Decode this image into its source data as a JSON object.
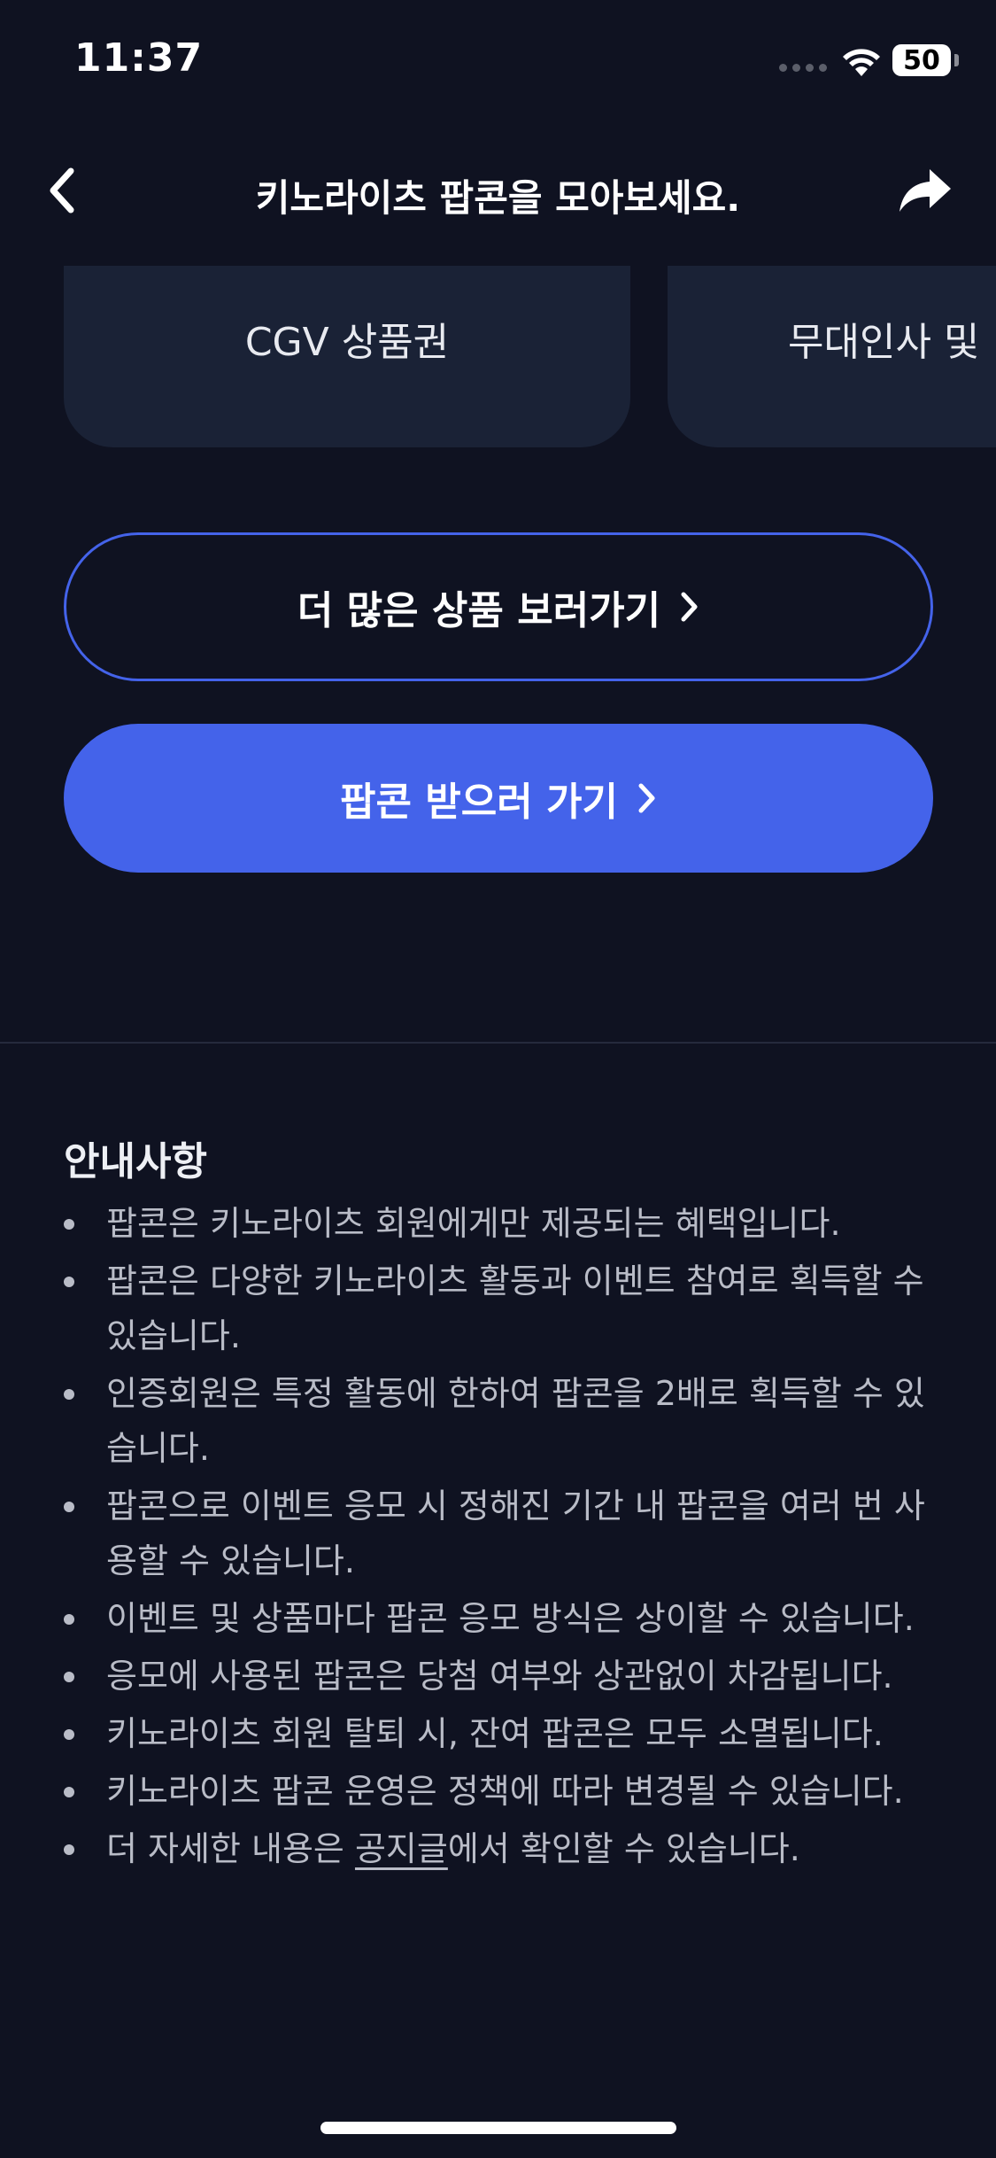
{
  "status_bar": {
    "time": "11:37",
    "battery": "50"
  },
  "nav": {
    "title": "키노라이츠 팝콘을 모아보세요."
  },
  "products": [
    {
      "label": "CGV 상품권"
    },
    {
      "label": "무대인사 및"
    }
  ],
  "buttons": {
    "more_products": "더 많은 상품 보러가기",
    "get_popcorn": "팝콘 받으러 가기"
  },
  "notice": {
    "title": "안내사항",
    "items": [
      "팝콘은 키노라이츠 회원에게만 제공되는 혜택입니다.",
      "팝콘은 다양한 키노라이츠 활동과 이벤트 참여로 획득할 수 있습니다.",
      "인증회원은 특정 활동에 한하여 팝콘을 2배로 획득할 수 있습니다.",
      "팝콘으로 이벤트 응모 시 정해진 기간 내 팝콘을 여러 번 사용할 수 있습니다.",
      "이벤트 및 상품마다 팝콘 응모 방식은 상이할 수 있습니다.",
      "응모에 사용된 팝콘은 당첨 여부와 상관없이 차감됩니다.",
      "키노라이츠 회원 탈퇴 시, 잔여 팝콘은 모두 소멸됩니다.",
      "키노라이츠 팝콘 운영은 정책에 따라 변경될 수 있습니다."
    ],
    "last_item": {
      "prefix": "더 자세한 내용은 ",
      "link": "공지글",
      "suffix": "에서 확인할 수 있습니다."
    }
  },
  "colors": {
    "background": "#0f1221",
    "accent": "#4463ea",
    "card": "#1a2236",
    "notice_text": "#b9bcc7"
  },
  "icons": {
    "back": "chevron-left-icon",
    "share": "share-arrow-icon",
    "wifi": "wifi-icon",
    "chevron": "chevron-right-icon"
  }
}
